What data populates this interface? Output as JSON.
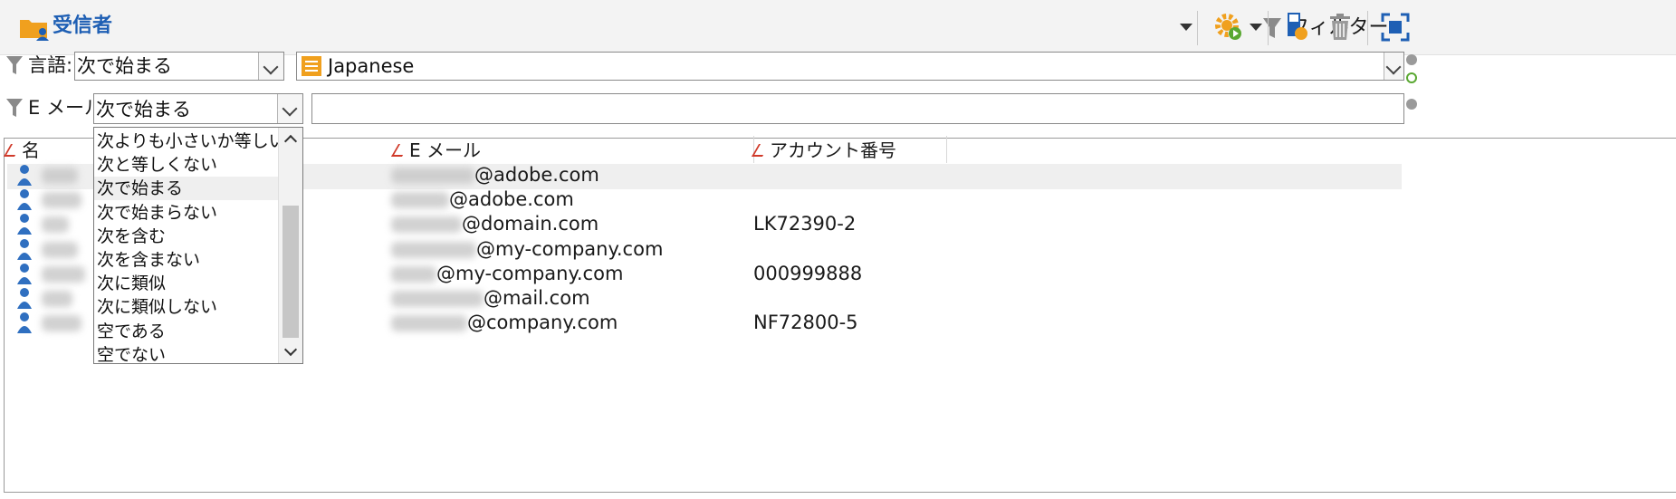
{
  "window": {
    "title": "受信者"
  },
  "toolbar": {
    "filter_label": "フィルター",
    "icons": [
      "filter-icon",
      "gear-action-icon",
      "new-record-icon",
      "delete-icon",
      "fit-screen-icon"
    ]
  },
  "filters": [
    {
      "label": "言語:",
      "operator": "次で始まる",
      "value": "Japanese"
    },
    {
      "label": "E メール:",
      "operator": "次で始まる",
      "value": ""
    }
  ],
  "dropdown": {
    "selected": "次で始まる",
    "options": [
      "次よりも小さいか等しい",
      "次と等しくない",
      "次で始まる",
      "次で始まらない",
      "次を含む",
      "次を含まない",
      "次に類似",
      "次に類似しない",
      "空である",
      "空でない"
    ]
  },
  "table": {
    "columns": [
      "名",
      "E メール",
      "アカウント番号"
    ],
    "rows": [
      {
        "email_domain": "@adobe.com",
        "account": ""
      },
      {
        "email_domain": "@adobe.com",
        "account": ""
      },
      {
        "email_domain": "@domain.com",
        "account": "LK72390-2"
      },
      {
        "email_domain": "@my-company.com",
        "account": ""
      },
      {
        "email_domain": "@my-company.com",
        "account": "000999888"
      },
      {
        "email_domain": "@mail.com",
        "account": ""
      },
      {
        "email_domain": "@company.com",
        "account": "NF72800-5"
      }
    ]
  },
  "colors": {
    "title": "#1e5fb4",
    "accent_orange": "#f0a01e",
    "accent_green": "#5aa832",
    "sort_red": "#d03a2a"
  }
}
